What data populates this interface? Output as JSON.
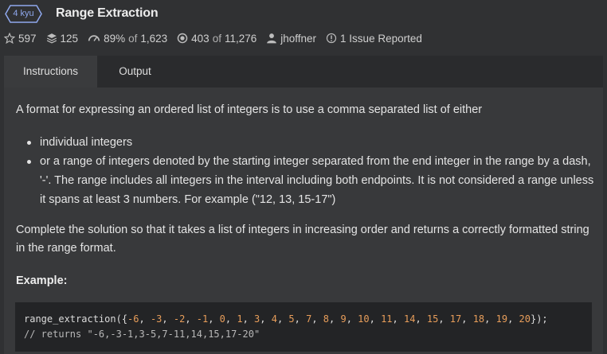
{
  "kata": {
    "rank": "4 kyu",
    "title": "Range Extraction"
  },
  "stats": {
    "stars": "597",
    "collections": "125",
    "satisfaction_pct": "89%",
    "satisfaction_of": "of",
    "satisfaction_total": "1,623",
    "completed": "403",
    "completed_of": "of",
    "completed_total": "11,276",
    "author": "jhoffner",
    "issues": "1 Issue Reported"
  },
  "tabs": [
    {
      "label": "Instructions",
      "active": true
    },
    {
      "label": "Output",
      "active": false
    }
  ],
  "description": {
    "intro": "A format for expressing an ordered list of integers is to use a comma separated list of either",
    "bullets": [
      "individual integers",
      "or a range of integers denoted by the starting integer separated from the end integer in the range by a dash, '-'. The range includes all integers in the interval including both endpoints. It is not considered a range unless it spans at least 3 numbers. For example (\"12, 13, 15-17\")"
    ],
    "task": "Complete the solution so that it takes a list of integers in increasing order and returns a correctly formatted string in the range format.",
    "example_heading": "Example:"
  },
  "code": {
    "func_open": "range_extraction({",
    "numbers": [
      "-6",
      "-3",
      "-2",
      "-1",
      "0",
      "1",
      "3",
      "4",
      "5",
      "7",
      "8",
      "9",
      "10",
      "11",
      "14",
      "15",
      "17",
      "18",
      "19",
      "20"
    ],
    "func_close": "});",
    "comment": "// returns \"-6,-3-1,3-5,7-11,14,15,17-20\""
  },
  "colors": {
    "background": "#303133",
    "panel": "#38393b",
    "code_bg": "#232426",
    "number": "#e79d5a",
    "rank_badge": "#8fa8ee"
  },
  "icons": [
    "star-icon",
    "collections-icon",
    "satisfaction-icon",
    "completed-icon",
    "user-icon",
    "issue-icon"
  ]
}
